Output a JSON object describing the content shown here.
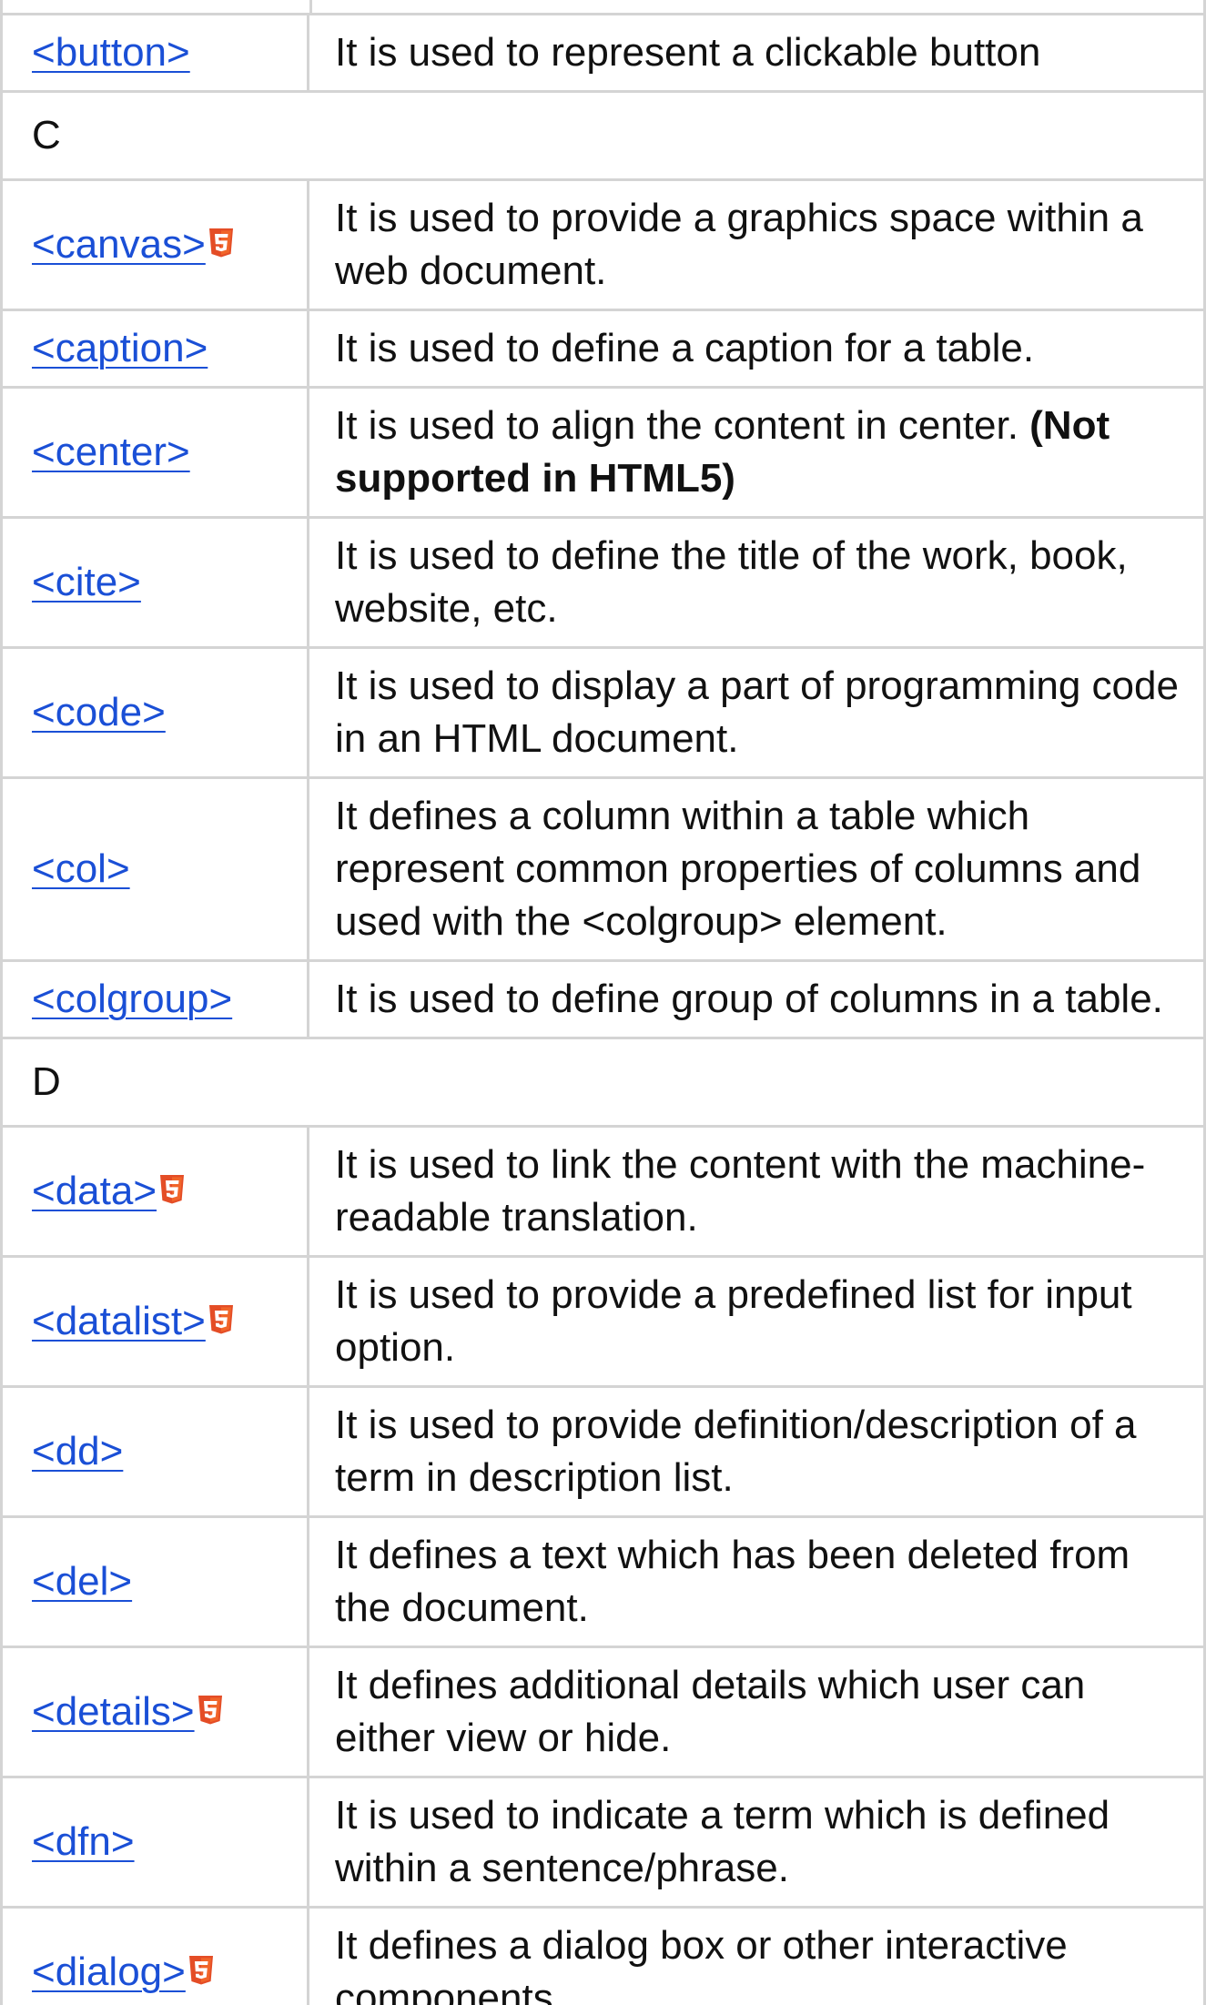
{
  "rows": [
    {
      "kind": "tag",
      "tag": "<button>",
      "html5": false,
      "description": "It is used to represent a clickable button",
      "note": ""
    },
    {
      "kind": "letter",
      "letter": "C"
    },
    {
      "kind": "tag",
      "tag": "<canvas>",
      "html5": true,
      "description": "It is used to provide a graphics space within a web document.",
      "note": ""
    },
    {
      "kind": "tag",
      "tag": "<caption>",
      "html5": false,
      "description": "It is used to define a caption for a table.",
      "note": ""
    },
    {
      "kind": "tag",
      "tag": "<center>",
      "html5": false,
      "description": "It is used to align the content in center. ",
      "note": "(Not supported in HTML5)"
    },
    {
      "kind": "tag",
      "tag": "<cite>",
      "html5": false,
      "description": "It is used to define the title of the work, book, website, etc.",
      "note": ""
    },
    {
      "kind": "tag",
      "tag": "<code>",
      "html5": false,
      "description": "It is used to display a part of programming code in an HTML document.",
      "note": ""
    },
    {
      "kind": "tag",
      "tag": "<col>",
      "html5": false,
      "description": "It defines a column within a table which represent common properties of columns and used with the <colgroup> element.",
      "note": ""
    },
    {
      "kind": "tag",
      "tag": "<colgroup>",
      "html5": false,
      "description": "It is used to define group of columns in a table.",
      "note": ""
    },
    {
      "kind": "letter",
      "letter": "D"
    },
    {
      "kind": "tag",
      "tag": "<data>",
      "html5": true,
      "description": "It is used to link the content with the machine-readable translation.",
      "note": ""
    },
    {
      "kind": "tag",
      "tag": "<datalist>",
      "html5": true,
      "description": "It is used to provide a predefined list for input option.",
      "note": ""
    },
    {
      "kind": "tag",
      "tag": "<dd>",
      "html5": false,
      "description": "It is used to provide definition/description of a term in description list.",
      "note": ""
    },
    {
      "kind": "tag",
      "tag": "<del>",
      "html5": false,
      "description": "It defines a text which has been deleted from the document.",
      "note": ""
    },
    {
      "kind": "tag",
      "tag": "<details>",
      "html5": true,
      "description": "It defines additional details which user can either view or hide.",
      "note": ""
    },
    {
      "kind": "tag",
      "tag": "<dfn>",
      "html5": false,
      "description": "It is used to indicate a term which is defined within a sentence/phrase.",
      "note": ""
    },
    {
      "kind": "tag",
      "tag": "<dialog>",
      "html5": true,
      "description": "It defines a dialog box or other interactive components.",
      "note": ""
    }
  ],
  "colors": {
    "link": "#1a4fd6",
    "border": "#d4d4d4",
    "html5_badge": "#e44d26"
  },
  "icons": {
    "html5_badge": "html5-icon"
  }
}
